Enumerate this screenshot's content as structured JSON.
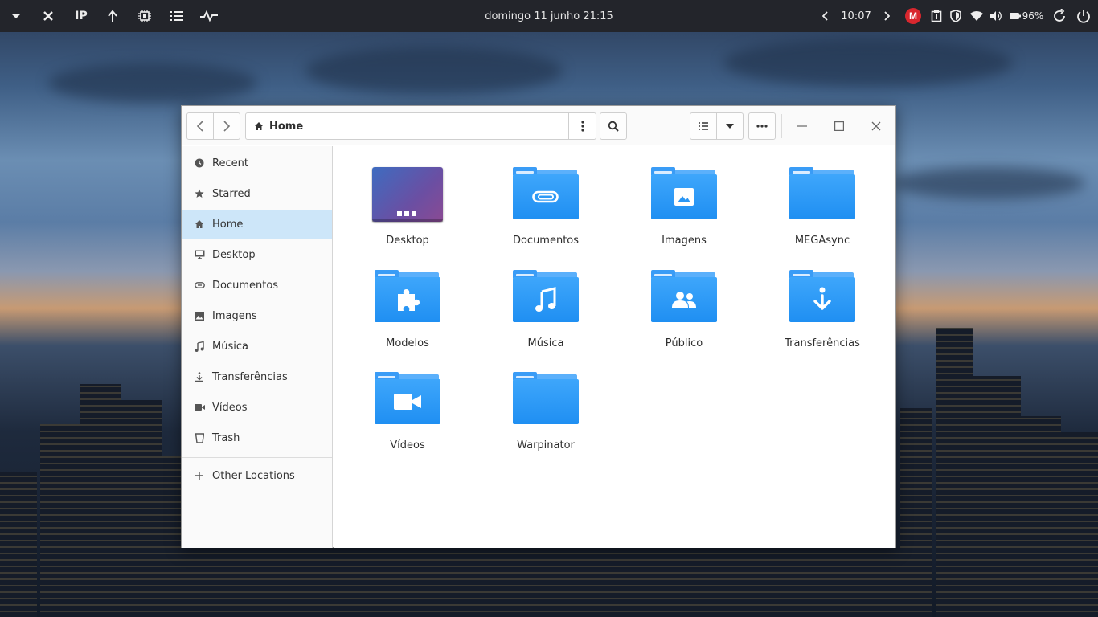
{
  "panel": {
    "left_icons": [
      "menu-arrow-icon",
      "close-icon",
      "ip-indicator",
      "upload-icon",
      "cpu-icon",
      "list-icon",
      "pulse-icon"
    ],
    "ip_label": "IP",
    "clock": "domingo 11 junho  21:15",
    "secondary_time": "10:07",
    "mega_label": "M",
    "battery": "96%",
    "right_icons": [
      "chevron-left-icon",
      "chevron-right-icon",
      "mega-icon",
      "clipboard-icon",
      "shield-icon",
      "wifi-icon",
      "volume-icon",
      "battery-icon",
      "refresh-icon",
      "power-icon"
    ]
  },
  "window": {
    "path_label": "Home",
    "colors": {
      "accent": "#2a96f4",
      "selection": "#cde6f9"
    }
  },
  "sidebar": {
    "items": [
      {
        "label": "Recent",
        "icon": "clock-icon"
      },
      {
        "label": "Starred",
        "icon": "star-icon"
      },
      {
        "label": "Home",
        "icon": "home-icon",
        "active": true
      },
      {
        "label": "Desktop",
        "icon": "monitor-icon"
      },
      {
        "label": "Documentos",
        "icon": "paperclip-icon"
      },
      {
        "label": "Imagens",
        "icon": "image-icon"
      },
      {
        "label": "Música",
        "icon": "music-icon"
      },
      {
        "label": "Transferências",
        "icon": "download-icon"
      },
      {
        "label": "Vídeos",
        "icon": "video-icon"
      },
      {
        "label": "Trash",
        "icon": "trash-icon"
      }
    ],
    "other_locations": "Other Locations"
  },
  "files": [
    {
      "label": "Desktop",
      "icon": "desktop-icon"
    },
    {
      "label": "Documentos",
      "icon": "paperclip-folder-icon"
    },
    {
      "label": "Imagens",
      "icon": "image-folder-icon"
    },
    {
      "label": "MEGAsync",
      "icon": "folder-icon"
    },
    {
      "label": "Modelos",
      "icon": "puzzle-folder-icon"
    },
    {
      "label": "Música",
      "icon": "music-folder-icon"
    },
    {
      "label": "Público",
      "icon": "people-folder-icon"
    },
    {
      "label": "Transferências",
      "icon": "download-folder-icon"
    },
    {
      "label": "Vídeos",
      "icon": "video-folder-icon"
    },
    {
      "label": "Warpinator",
      "icon": "folder-icon"
    }
  ]
}
